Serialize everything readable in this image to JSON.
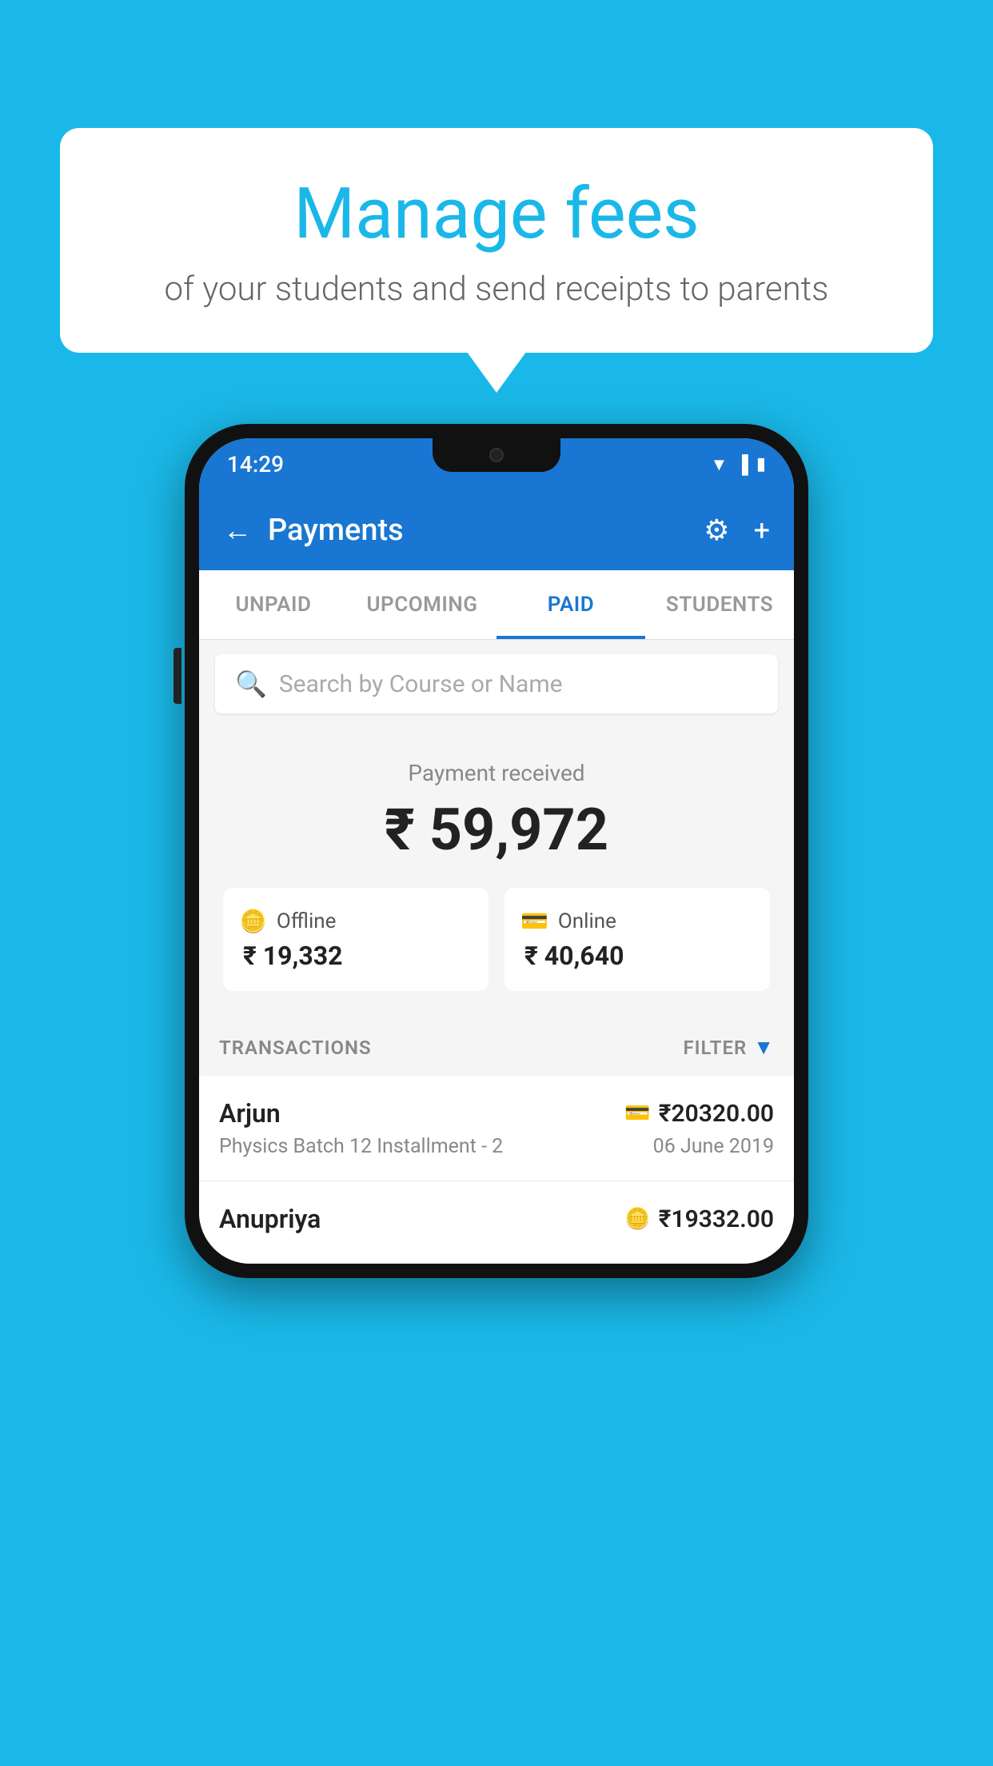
{
  "background_color": "#1AB8E8",
  "speech_bubble": {
    "headline": "Manage fees",
    "subtext": "of your students and send receipts to parents"
  },
  "phone": {
    "status_bar": {
      "time": "14:29",
      "icons": [
        "wifi",
        "signal",
        "battery"
      ]
    },
    "app_bar": {
      "title": "Payments",
      "back_icon": "←",
      "settings_icon": "⚙",
      "add_icon": "+"
    },
    "tabs": [
      {
        "label": "UNPAID",
        "active": false
      },
      {
        "label": "UPCOMING",
        "active": false
      },
      {
        "label": "PAID",
        "active": true
      },
      {
        "label": "STUDENTS",
        "active": false
      }
    ],
    "search": {
      "placeholder": "Search by Course or Name",
      "icon": "🔍"
    },
    "payment_summary": {
      "label": "Payment received",
      "total": "₹ 59,972",
      "offline": {
        "type": "Offline",
        "amount": "₹ 19,332"
      },
      "online": {
        "type": "Online",
        "amount": "₹ 40,640"
      }
    },
    "transactions": {
      "header_label": "TRANSACTIONS",
      "filter_label": "FILTER",
      "rows": [
        {
          "name": "Arjun",
          "detail": "Physics Batch 12 Installment - 2",
          "amount": "₹20320.00",
          "date": "06 June 2019",
          "payment_type": "online"
        },
        {
          "name": "Anupriya",
          "amount": "₹19332.00",
          "payment_type": "offline"
        }
      ]
    }
  }
}
